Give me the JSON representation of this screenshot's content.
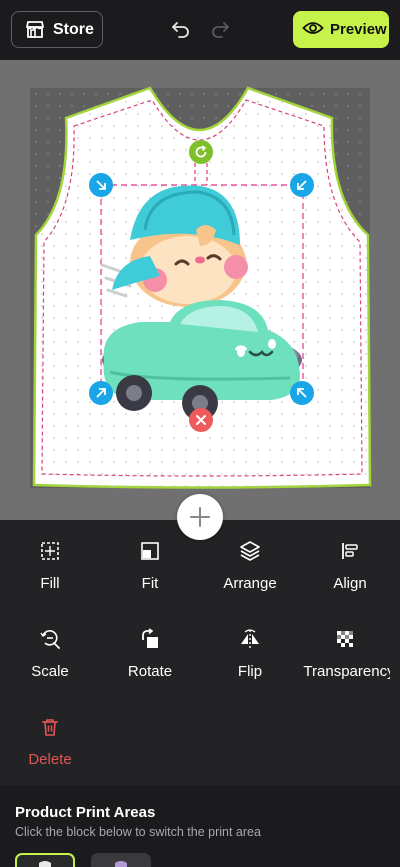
{
  "topbar": {
    "store_label": "Store",
    "preview_label": "Preview"
  },
  "tools": {
    "fill": "Fill",
    "fit": "Fit",
    "arrange": "Arrange",
    "align": "Align",
    "scale": "Scale",
    "rotate": "Rotate",
    "flip": "Flip",
    "transparency": "Transparency",
    "delete": "Delete"
  },
  "print_areas": {
    "title": "Product Print Areas",
    "subtitle": "Click the block below to switch the print area"
  },
  "colors": {
    "accent": "#c6f24a",
    "handle_blue": "#1aa6e6",
    "rotate_green": "#7ec02b",
    "delete_red": "#ee5b5b"
  }
}
